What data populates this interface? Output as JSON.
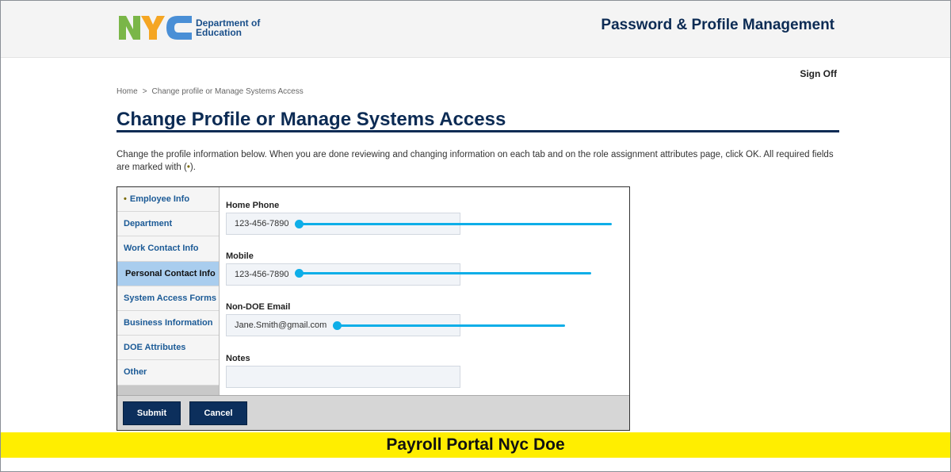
{
  "header": {
    "logo_text": "NYC",
    "logo_subtitle_line1": "Department of",
    "logo_subtitle_line2": "Education",
    "title": "Password & Profile Management"
  },
  "signoff_label": "Sign Off",
  "breadcrumb": {
    "home": "Home",
    "separator": ">",
    "current": "Change profile or Manage Systems Access"
  },
  "page_title": "Change Profile or Manage Systems Access",
  "intro": {
    "text": "Change the profile information below. When you are done reviewing and changing information on each tab and on the role assignment attributes page, click OK. All required fields are marked with (",
    "req_symbol": "•",
    "text_end": ")."
  },
  "tabs": [
    {
      "label": "Employee Info",
      "required_marker": "•"
    },
    {
      "label": "Department"
    },
    {
      "label": "Work Contact Info"
    },
    {
      "label": "Personal Contact Info",
      "active": true
    },
    {
      "label": "System Access Forms"
    },
    {
      "label": "Business Information"
    },
    {
      "label": "DOE Attributes"
    },
    {
      "label": "Other"
    }
  ],
  "fields": {
    "home_phone": {
      "label": "Home Phone",
      "value": "123-456-7890"
    },
    "mobile": {
      "label": "Mobile",
      "value": "123-456-7890"
    },
    "non_doe_email": {
      "label": "Non-DOE Email",
      "value": "Jane.Smith@gmail.com"
    },
    "notes": {
      "label": "Notes",
      "value": ""
    }
  },
  "buttons": {
    "submit": "Submit",
    "cancel": "Cancel"
  },
  "banner": "Payroll Portal Nyc Doe",
  "colors": {
    "navy": "#0c2b54",
    "link_blue": "#1b5a96",
    "active_tab": "#a9cdee",
    "highlight_marker": "#0eaee8",
    "banner_yellow": "#ffee00",
    "logo_green": "#7ab648",
    "logo_orange": "#f5a623",
    "logo_blue": "#4a8fd6"
  }
}
